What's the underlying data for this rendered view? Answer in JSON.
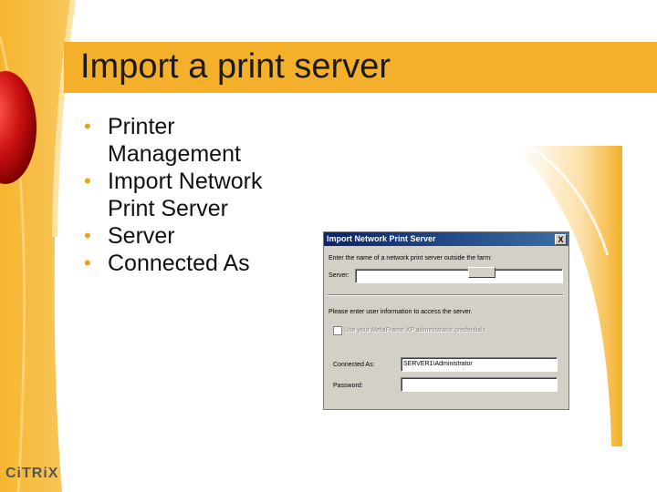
{
  "slide": {
    "title": "Import a print server",
    "bullets": [
      "Printer Management",
      "Import Network Print Server",
      "Server",
      "Connected As"
    ],
    "logo_text": "CiTRiX"
  },
  "dialog": {
    "title": "Import Network Print Server",
    "close_label": "X",
    "prompt": "Enter the name of a network print server outside the farm:",
    "server_label": "Server:",
    "server_value": "",
    "user_info_text": "Please enter user information to access the server.",
    "checkbox_label": "Use your MetaFrame XP administrator credentials",
    "connected_as_label": "Connected As:",
    "connected_as_value": "SERVER1\\Administrator",
    "password_label": "Password:",
    "password_value": ""
  },
  "colors": {
    "accent": "#f4b02a",
    "red_sphere": "#cc1111",
    "dialog_face": "#d4d0c8"
  }
}
